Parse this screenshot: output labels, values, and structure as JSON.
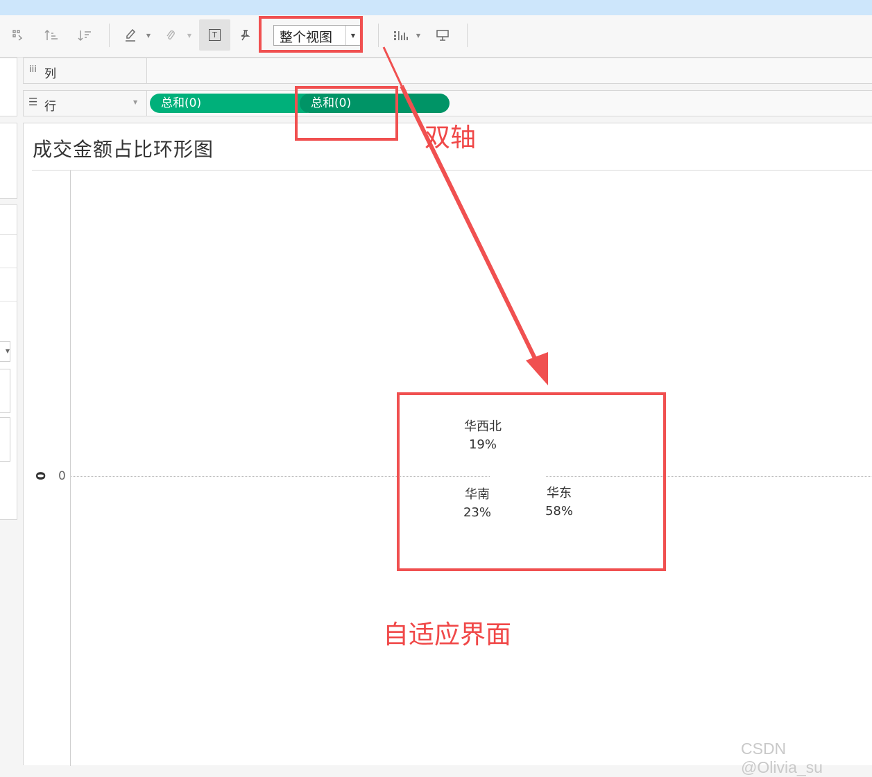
{
  "toolbar": {
    "fit_label": "整个视图"
  },
  "shelves": {
    "columns_label": "列",
    "rows_label": "行",
    "row_pills": [
      {
        "label": "总和(0)",
        "color": "#00b07a"
      },
      {
        "label": "总和(0)",
        "color": "#009466"
      }
    ]
  },
  "sheet": {
    "title": "成交金额占比环形图",
    "axis_title": "0",
    "axis_tick": "0",
    "slices": [
      {
        "region": "华西北",
        "percent": "19%",
        "share": 0.19
      },
      {
        "region": "华南",
        "percent": "23%",
        "share": 0.23
      },
      {
        "region": "华东",
        "percent": "58%",
        "share": 0.58
      }
    ]
  },
  "annotations": {
    "dual_axis": "双轴",
    "adaptive": "自适应界面",
    "color": "#f05050"
  },
  "watermark": "CSDN @Olivia_su"
}
